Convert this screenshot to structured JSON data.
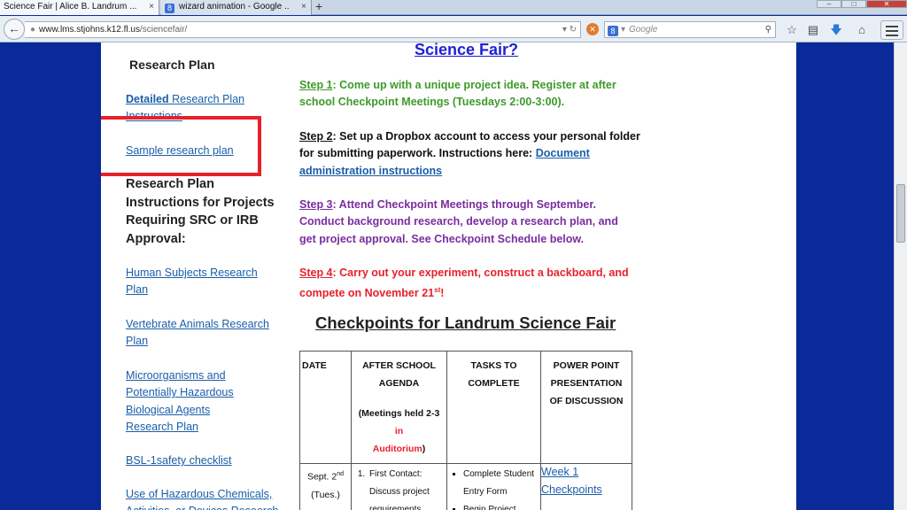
{
  "browser": {
    "tabs": [
      {
        "label": "Science Fair | Alice B. Landrum ...",
        "close": "×"
      },
      {
        "label": "wizard animation - Google ...",
        "close": "×",
        "favicon": "8"
      }
    ],
    "new_tab": "+",
    "window_controls": {
      "minimize": "–",
      "maximize": "□",
      "close": "✕"
    },
    "url": {
      "host": "www.lms.stjohns.k12.fl.us",
      "path": "/sciencefair/"
    },
    "search": {
      "engine_icon": "8",
      "placeholder": "Google"
    },
    "icons": [
      "back-icon",
      "globe-icon",
      "reload-icon",
      "stop-icon",
      "search-icon",
      "star-icon",
      "clipboard-icon",
      "download-icon",
      "home-icon",
      "menu-icon"
    ]
  },
  "sidebar": {
    "title": "Research Plan",
    "detailed_bold": "Detailed",
    "detailed_rest": " Research Plan Instructions",
    "sample": "Sample research plan",
    "heading": "Research Plan Instructions for Projects Requiring SRC or IRB Approval:",
    "links": [
      "Human Subjects Research Plan",
      "Vertebrate Animals Research Plan",
      "Microorganisms and Potentially Hazardous Biological Agents Research Plan",
      "BSL-1safety checklist",
      "Use of Hazardous Chemicals, Activities, or Devices Research"
    ]
  },
  "main": {
    "title": "Science Fair?",
    "step1_label": "Step 1",
    "step1_text": ":  Come up with a unique project idea.  Register at after school Checkpoint Meetings (Tuesdays 2:00-3:00).",
    "step2_label": "Step 2",
    "step2_text": ":  Set up a Dropbox account to access your personal folder for submitting paperwork.  Instructions here: ",
    "step2_link": "Document administration instructions",
    "step3_label": "Step 3",
    "step3_text": ":  Attend Checkpoint Meetings through September.  Conduct background research, develop a research plan, and get project approval. See Checkpoint Schedule below.",
    "step4_label": "Step 4",
    "step4_text": ":  Carry out your experiment, construct a backboard, and compete on November 21",
    "step4_sup": "st",
    "step4_end": "!",
    "checkpoints_title": "Checkpoints for Landrum Science Fair"
  },
  "table": {
    "headers": {
      "date": "DATE",
      "after": "AFTER SCHOOL AGENDA",
      "meetings_a": "(Meetings held 2-3 ",
      "meetings_in": "in",
      "meetings_b": "Auditorium",
      "meetings_c": ")",
      "tasks": "TASKS TO COMPLETE",
      "ppt": "POWER POINT PRESENTATION OF DISCUSSION"
    },
    "row1": {
      "date_a": "Sept. 2",
      "date_sup": "nd",
      "date_b": "(Tues.)",
      "agenda_item": "First Contact: Discuss project requirements",
      "tasks": [
        "Complete Student Entry Form",
        "Begin Project"
      ],
      "ppt_link": "Week 1 Checkpoints"
    }
  },
  "colors": {
    "page_bg": "#0a2a9a",
    "link": "#1a5ea8",
    "title_blue": "#1f1fd6",
    "step_green": "#3d9a2a",
    "step_purple": "#7a2d9d",
    "step_red": "#e8202a",
    "highlight": "#e8202a"
  }
}
